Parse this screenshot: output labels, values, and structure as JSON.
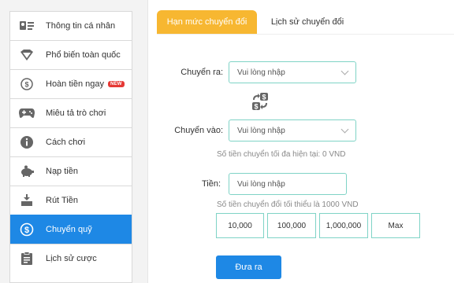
{
  "sidebar": {
    "items": [
      {
        "label": "Thông tin cá nhân",
        "icon": "profile-card-icon"
      },
      {
        "label": "Phổ biến toàn quốc",
        "icon": "diamond-icon"
      },
      {
        "label": "Hoàn tiền ngay",
        "icon": "refund-coin-icon",
        "badge": "NEW"
      },
      {
        "label": "Miêu tả trò chơi",
        "icon": "gamepad-icon"
      },
      {
        "label": "Cách chơi",
        "icon": "info-icon"
      },
      {
        "label": "Nạp tiền",
        "icon": "piggy-bank-icon"
      },
      {
        "label": "Rút Tiền",
        "icon": "withdraw-icon"
      },
      {
        "label": "Chuyển quỹ",
        "icon": "dollar-coin-icon",
        "active": true
      },
      {
        "label": "Lịch sử cược",
        "icon": "clipboard-icon"
      }
    ]
  },
  "tabs": {
    "limit": "Hạn mức chuyển đổi",
    "history": "Lịch sử chuyển đổi"
  },
  "form": {
    "from_label": "Chuyển ra:",
    "from_value": "Vui lòng nhập",
    "to_label": "Chuyển vào:",
    "to_value": "Vui lòng nhập",
    "max_hint": "Số tiền chuyển tối đa hiện tại:  0 VND",
    "amount_label": "Tiền:",
    "amount_placeholder": "Vui lòng nhập",
    "min_hint": "Số tiền chuyển đổi tối thiểu là 1000 VND",
    "quick_amounts": [
      "10,000",
      "100,000",
      "1,000,000",
      "Max"
    ],
    "submit": "Đưa ra"
  },
  "colors": {
    "accent_blue": "#1e88e5",
    "tab_orange": "#f7b731",
    "field_border": "#7fd3c6",
    "badge_red": "#e53935"
  }
}
